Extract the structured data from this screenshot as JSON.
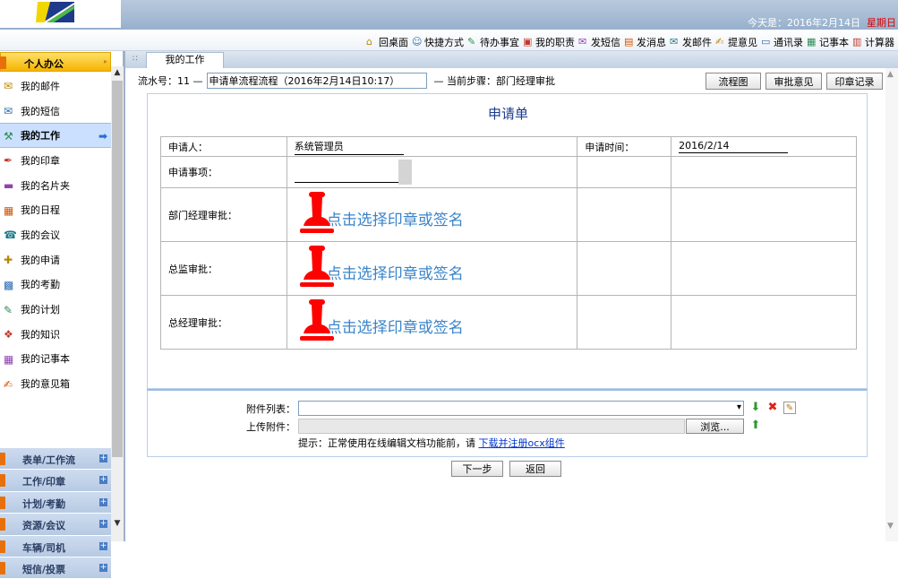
{
  "header": {
    "date_prefix": "今天是：",
    "date": "2016年2月14日",
    "weekday": "星期日",
    "colors": {
      "banner": "#97b0cd",
      "weekday": "#e00000"
    }
  },
  "quickbar": [
    {
      "label": "回桌面",
      "icon": "home-icon"
    },
    {
      "label": "快捷方式",
      "icon": "smiley-icon"
    },
    {
      "label": "待办事宜",
      "icon": "todo-icon"
    },
    {
      "label": "我的职责",
      "icon": "duty-icon"
    },
    {
      "label": "发短信",
      "icon": "sms-icon"
    },
    {
      "label": "发消息",
      "icon": "message-icon"
    },
    {
      "label": "发邮件",
      "icon": "mail-icon"
    },
    {
      "label": "提意见",
      "icon": "suggest-icon"
    },
    {
      "label": "通讯录",
      "icon": "contacts-icon"
    },
    {
      "label": "记事本",
      "icon": "notepad-icon"
    },
    {
      "label": "计算器",
      "icon": "calculator-icon"
    }
  ],
  "sidebar": {
    "header": "个人办公",
    "items": [
      {
        "label": "我的邮件",
        "icon": "mail-icon"
      },
      {
        "label": "我的短信",
        "icon": "sms-icon"
      },
      {
        "label": "我的工作",
        "icon": "work-icon",
        "active": true
      },
      {
        "label": "我的印章",
        "icon": "seal-icon"
      },
      {
        "label": "我的名片夹",
        "icon": "card-icon"
      },
      {
        "label": "我的日程",
        "icon": "calendar-icon"
      },
      {
        "label": "我的会议",
        "icon": "meeting-icon"
      },
      {
        "label": "我的申请",
        "icon": "apply-icon"
      },
      {
        "label": "我的考勤",
        "icon": "attendance-icon"
      },
      {
        "label": "我的计划",
        "icon": "plan-icon"
      },
      {
        "label": "我的知识",
        "icon": "knowledge-icon"
      },
      {
        "label": "我的记事本",
        "icon": "notepad-icon"
      },
      {
        "label": "我的意见箱",
        "icon": "suggest-icon"
      }
    ],
    "categories": [
      "表单/工作流",
      "工作/印章",
      "计划/考勤",
      "资源/会议",
      "车辆/司机",
      "短信/投票"
    ]
  },
  "tab": {
    "label": "我的工作"
  },
  "flow": {
    "serial_label": "流水号：11 —",
    "name": "申请单流程流程（2016年2月14日10:17）",
    "step_label": "— 当前步骤：部门经理审批",
    "buttons": [
      "流程图",
      "审批意见",
      "印章记录"
    ]
  },
  "form": {
    "title": "申请单",
    "applicant_label": "申请人：",
    "applicant": "系统管理员",
    "time_label": "申请时间：",
    "time": "2016/2/14",
    "matter_label": "申请事项：",
    "matter": "",
    "approvals": [
      {
        "label": "部门经理审批：",
        "seal_text": "点击选择印章或签名"
      },
      {
        "label": "总监审批：",
        "seal_text": "点击选择印章或签名"
      },
      {
        "label": "总经理审批：",
        "seal_text": "点击选择印章或签名"
      }
    ],
    "colors": {
      "seal": "#ff0000",
      "seal_text": "#3a84c9"
    }
  },
  "attachments": {
    "list_label": "附件列表：",
    "upload_label": "上传附件：",
    "browse": "浏览...",
    "hint_prefix": "提示：正常使用在线编辑文档功能前，请 ",
    "hint_link": "下载并注册ocx组件"
  },
  "actions": {
    "next": "下一步",
    "back": "返回"
  }
}
